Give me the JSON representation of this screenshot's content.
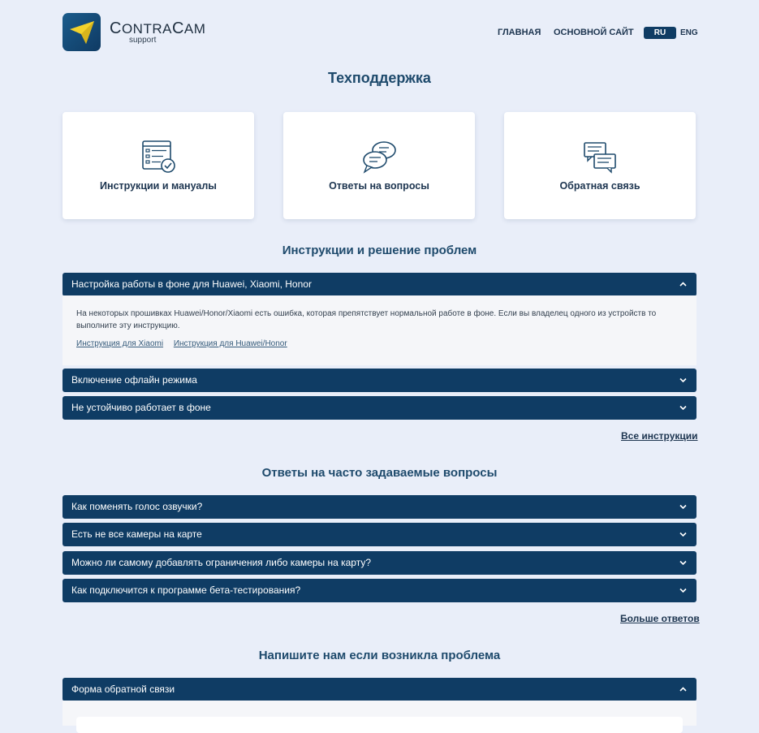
{
  "brand": {
    "name_prefix": "C",
    "name_rest_1": "ONTRA",
    "name_cap_2": "C",
    "name_rest_2": "AM",
    "sub": "support"
  },
  "nav": {
    "home": "ГЛАВНАЯ",
    "main_site": "ОСНОВНОЙ САЙТ",
    "lang_active": "RU",
    "lang_other": "ENG"
  },
  "page_title": "Техподдержка",
  "cards": [
    {
      "label": "Инструкции и мануалы",
      "icon": "checklist-icon"
    },
    {
      "label": "Ответы на вопросы",
      "icon": "chat-bubbles-icon"
    },
    {
      "label": "Обратная связь",
      "icon": "messages-icon"
    }
  ],
  "instructions": {
    "title": "Инструкции и решение проблем",
    "items": [
      {
        "label": "Настройка работы в фоне для Huawei, Xiaomi, Honor",
        "expanded": true,
        "body": "На некоторых прошивках Huawei/Honor/Xiaomi есть ошибка, которая препятствует нормальной работе в фоне. Если вы владелец одного из устройств то выполните эту инструкцию.",
        "links": [
          "Инструкция для Xiaomi",
          "Инструкция для Huawei/Honor"
        ]
      },
      {
        "label": "Включение офлайн режима",
        "expanded": false
      },
      {
        "label": "Не устойчиво работает в фоне",
        "expanded": false
      }
    ],
    "all_link": "Все инструкции"
  },
  "faq": {
    "title": "Ответы на часто задаваемые вопросы",
    "items": [
      {
        "label": "Как поменять голос озвучки?"
      },
      {
        "label": "Есть не все камеры на карте"
      },
      {
        "label": "Можно ли самому добавлять ограничения либо камеры на карту?"
      },
      {
        "label": "Как подключится к программе бета-тестирования?"
      }
    ],
    "more_link": "Больше ответов"
  },
  "feedback": {
    "title": "Напишите нам если возникла проблема",
    "form_label": "Форма обратной связи"
  },
  "colors": {
    "accent": "#0f3c64",
    "background": "#e9eef9",
    "title": "#1e4a6c"
  }
}
